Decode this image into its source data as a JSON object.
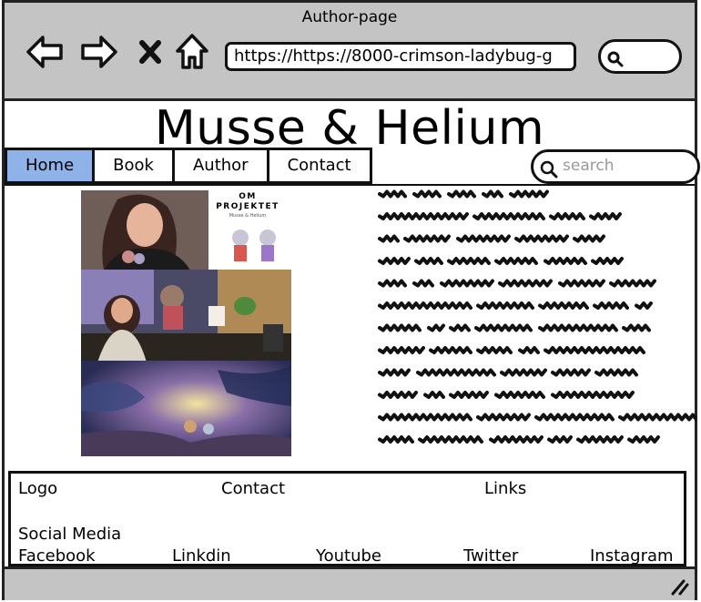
{
  "window": {
    "title": "Author-page"
  },
  "browser": {
    "url": "https://https://8000-crimson-ladybug-g",
    "back_icon": "back-arrow-icon",
    "forward_icon": "forward-arrow-icon",
    "stop_icon": "close-icon",
    "home_icon": "home-icon",
    "search_icon": "search-icon"
  },
  "site": {
    "title": "Musse & Helium"
  },
  "nav": {
    "tabs": [
      {
        "label": "Home",
        "active": true
      },
      {
        "label": "Book",
        "active": false
      },
      {
        "label": "Author",
        "active": false
      },
      {
        "label": "Contact",
        "active": false
      }
    ]
  },
  "search": {
    "placeholder": "search"
  },
  "images": {
    "promo_title": "OM PROJEKTET",
    "promo_subtitle": "Musse & Helium"
  },
  "footer": {
    "logo": "Logo",
    "contact": "Contact",
    "links": "Links",
    "social_heading": "Social Media",
    "social": [
      "Facebook",
      "Linkdin",
      "Youtube",
      "Twitter",
      "Instagram"
    ]
  },
  "colors": {
    "chrome": "#c4c4c4",
    "active_tab": "#8fb2e8",
    "placeholder": "#9a9a9a"
  }
}
